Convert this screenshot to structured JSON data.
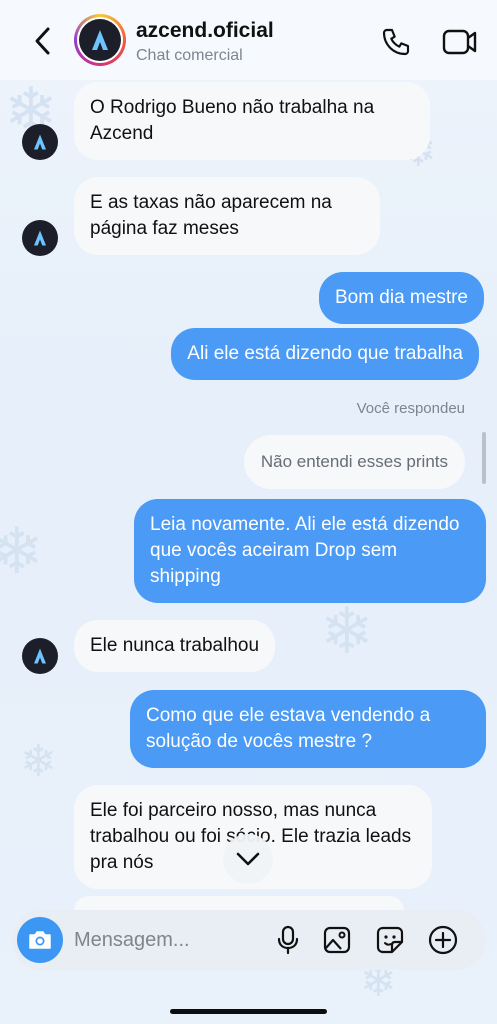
{
  "header": {
    "title": "azcend.oficial",
    "subtitle": "Chat comercial"
  },
  "messages": [
    {
      "direction": "in",
      "text": "O Rodrigo Bueno não trabalha na Azcend"
    },
    {
      "direction": "in",
      "text": "E as taxas não aparecem na página faz meses"
    },
    {
      "direction": "out",
      "text": "Bom dia mestre"
    },
    {
      "direction": "out",
      "text": "Ali ele está dizendo que trabalha"
    },
    {
      "direction": "out",
      "text": "Leia novamente. Ali ele está dizendo que vocês aceiram Drop sem shipping"
    },
    {
      "direction": "in",
      "text": "Ele nunca trabalhou"
    },
    {
      "direction": "out",
      "text": "Como que ele estava vendendo a solução de vocês mestre ?"
    },
    {
      "direction": "in",
      "text": "Ele foi parceiro nosso, mas nunca trabalhou ou foi sócio. Ele trazia leads pra nós"
    }
  ],
  "reply": {
    "label": "Você respondeu",
    "quoted_text": "Não entendi esses prints"
  },
  "composer": {
    "placeholder": "Mensagem..."
  },
  "icons": {
    "back": "chevron-left-icon",
    "call": "phone-icon",
    "video": "video-camera-icon",
    "camera": "camera-icon",
    "mic": "microphone-icon",
    "gallery": "image-icon",
    "sticker": "sticker-icon",
    "add": "plus-circle-icon",
    "scroll_down": "chevron-down-icon"
  },
  "colors": {
    "outgoing_bubble": "#4a9af6",
    "incoming_bubble": "#f7f8fa",
    "camera_button": "#3c97f4"
  }
}
